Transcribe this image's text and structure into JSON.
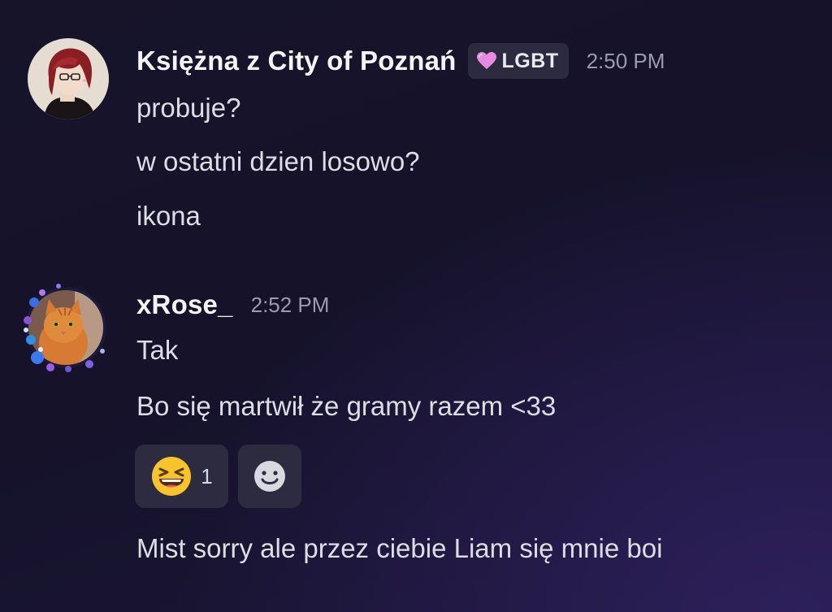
{
  "messages": [
    {
      "author": "Księżna z City of Poznań",
      "role": {
        "name": "LGBT",
        "icon": "pink-heart-icon",
        "color": "#e27ad8"
      },
      "time": "2:50 PM",
      "avatar": "anime-red-hair-glasses-avatar",
      "lines": [
        "probuje?",
        "w ostatni dzien losowo?",
        "ikona"
      ]
    },
    {
      "author": "xRose_",
      "time": "2:52 PM",
      "avatar": "orange-cat-flower-frame-avatar",
      "lines": [
        "Tak",
        "Bo się martwił że gramy razem <33",
        "Mist sorry ale przez ciebie Liam się mnie boi"
      ],
      "reactions": [
        {
          "emoji": "laughing-squint-emoji",
          "count": "1"
        },
        {
          "emoji": "add-reaction-smiley",
          "count": ""
        }
      ]
    }
  ]
}
